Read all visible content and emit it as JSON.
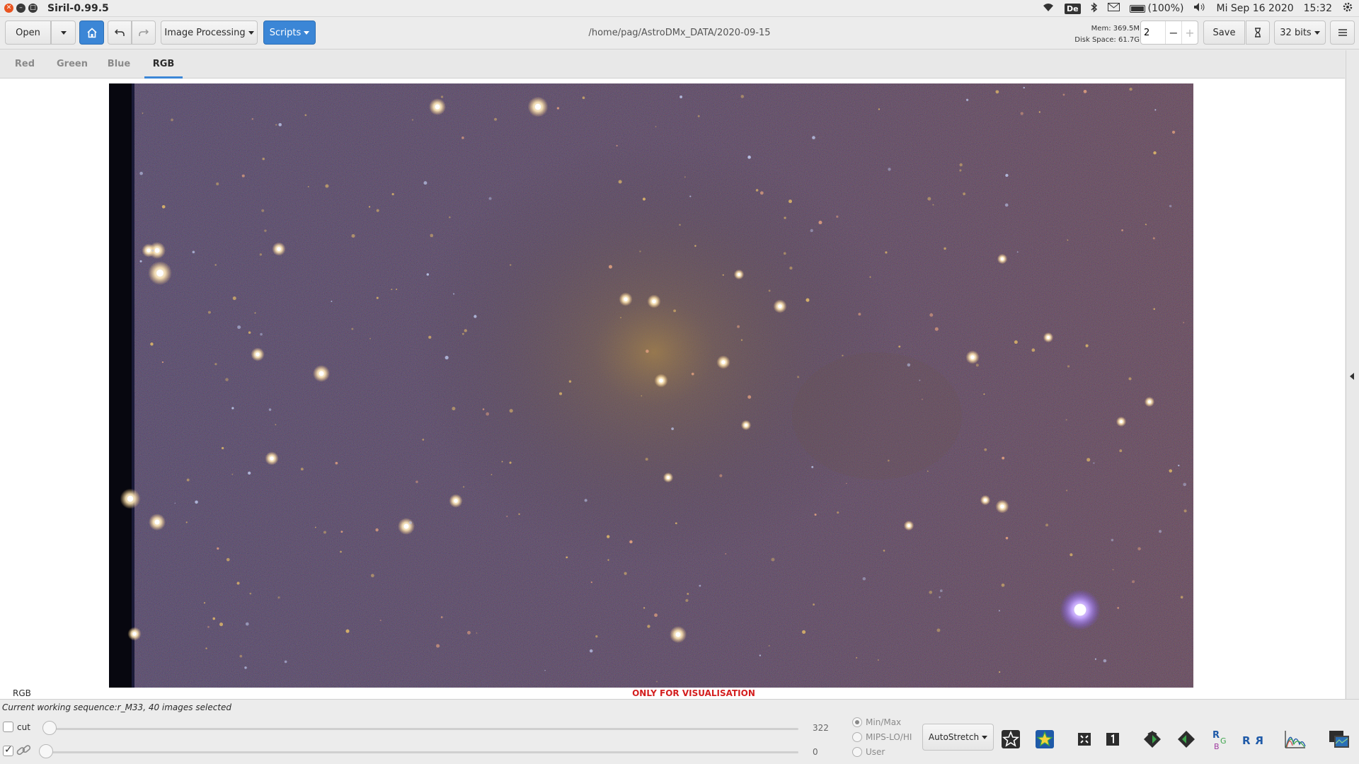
{
  "window": {
    "title": "Siril-0.99.5",
    "path": "/home/pag/AstroDMx_DATA/2020-09-15"
  },
  "system_tray": {
    "keyboard_layout": "De",
    "battery": "(100%)",
    "date": "Mi Sep 16 2020",
    "time": "15:32"
  },
  "toolbar": {
    "open_label": "Open",
    "image_processing_label": "Image Processing",
    "scripts_label": "Scripts",
    "mem": "Mem: 369.5M",
    "disk": "Disk Space: 61.7G",
    "threads_value": "2",
    "save_label": "Save",
    "bits_label": "32 bits"
  },
  "tabs": [
    {
      "label": "Red"
    },
    {
      "label": "Green"
    },
    {
      "label": "Blue"
    },
    {
      "label": "RGB"
    }
  ],
  "canvas": {
    "channel_label": "RGB",
    "visualisation_notice": "ONLY FOR VISUALISATION"
  },
  "bottom": {
    "sequence_text": "Current working sequence:r_M33, 40 images selected",
    "cut_label": "cut",
    "high_value": "322",
    "low_value": "0",
    "radio_options": [
      "Min/Max",
      "MIPS-LO/HI",
      "User"
    ],
    "selected_radio": "Min/Max",
    "stretch_label": "AutoStretch"
  },
  "colors": {
    "accent": "#3b86d6",
    "notice": "#d41f1f"
  },
  "icons": [
    "home-icon",
    "undo-icon",
    "redo-icon",
    "hourglass-icon",
    "hamburger-menu-icon",
    "star-outline-icon",
    "star-color-icon",
    "grid-icon",
    "one-to-one-icon",
    "rotate-left-icon",
    "rotate-right-icon",
    "flip-rgb-icon",
    "mirror-rgb-icon",
    "histogram-icon",
    "screens-icon"
  ]
}
